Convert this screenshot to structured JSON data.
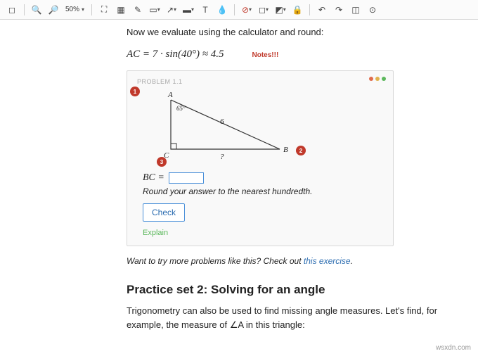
{
  "toolbar": {
    "zoom": "50%"
  },
  "content": {
    "intro": "Now we evaluate using the calculator and round:",
    "equation": "AC = 7 · sin(40°) ≈ 4.5",
    "notes_label": "Notes!!!",
    "problem_header": "PROBLEM 1.1",
    "triangle": {
      "A": "A",
      "B": "B",
      "C": "C",
      "angle": "65°",
      "hyp": "6",
      "base": "?"
    },
    "markers": {
      "m1": "1",
      "m2": "2",
      "m3": "3"
    },
    "bc_label": "BC =",
    "round_hint": "Round your answer to the nearest hundredth.",
    "check": "Check",
    "explain": "Explain",
    "more_prefix": "Want to try more problems like this? Check out ",
    "more_link": "this exercise",
    "more_suffix": ".",
    "h2": "Practice set 2: Solving for an angle",
    "para": "Trigonometry can also be used to find missing angle measures. Let's find, for example, the measure of ∠A in this triangle:"
  },
  "watermark": "wsxdn.com"
}
